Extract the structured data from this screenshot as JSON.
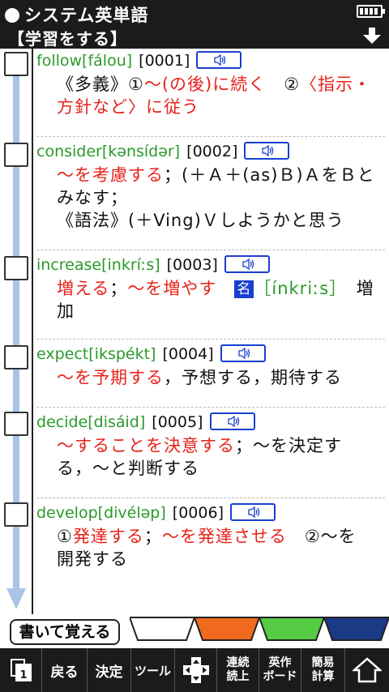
{
  "header": {
    "title": "システム英単語",
    "subtitle": "【学習をする】"
  },
  "entries": [
    {
      "word": "follow",
      "pron": "[fálou]",
      "number": "[0001]",
      "def_lines": [
        [
          {
            "t": "《多義》①",
            "c": ""
          },
          {
            "t": "〜(の後)に続く",
            "c": "red"
          },
          {
            "t": "　②",
            "c": ""
          },
          {
            "t": "〈指示・",
            "c": "red"
          }
        ],
        [
          {
            "t": "方針など〉に従う",
            "c": "red"
          }
        ]
      ]
    },
    {
      "word": "consider",
      "pron": "[kənsídər]",
      "number": "[0002]",
      "def_lines": [
        [
          {
            "t": "〜を考慮する",
            "c": "red"
          },
          {
            "t": "；(＋Ａ＋(as)Ｂ)ＡをＢと",
            "c": ""
          }
        ],
        [
          {
            "t": "みなす；",
            "c": ""
          }
        ],
        [
          {
            "t": "《語法》(＋Ving)Ｖしようかと思う",
            "c": ""
          }
        ]
      ]
    },
    {
      "word": "increase",
      "pron": "[inkríːs]",
      "number": "[0003]",
      "def_lines": [
        [
          {
            "t": "増える",
            "c": "red"
          },
          {
            "t": "；",
            "c": ""
          },
          {
            "t": "〜を増やす",
            "c": "red"
          },
          {
            "t": "　",
            "c": ""
          },
          {
            "t": "名",
            "c": "badge"
          },
          {
            "t": "［ínkriːs］",
            "c": "green"
          },
          {
            "t": "　増",
            "c": ""
          }
        ],
        [
          {
            "t": "加",
            "c": ""
          }
        ]
      ]
    },
    {
      "word": "expect",
      "pron": "[ikspékt]",
      "number": "[0004]",
      "def_lines": [
        [
          {
            "t": "〜を予期する",
            "c": "red"
          },
          {
            "t": "，予想する，期待する",
            "c": ""
          }
        ]
      ]
    },
    {
      "word": "decide",
      "pron": "[disáid]",
      "number": "[0005]",
      "def_lines": [
        [
          {
            "t": "〜することを決意する",
            "c": "red"
          },
          {
            "t": "；〜を決定す",
            "c": ""
          }
        ],
        [
          {
            "t": "る，〜と判断する",
            "c": ""
          }
        ]
      ]
    },
    {
      "word": "develop",
      "pron": "[divéləp]",
      "number": "[0006]",
      "def_lines": [
        [
          {
            "t": "①",
            "c": ""
          },
          {
            "t": "発達する",
            "c": "red"
          },
          {
            "t": "；",
            "c": ""
          },
          {
            "t": "〜を発達させる",
            "c": "red"
          },
          {
            "t": "　②〜を",
            "c": ""
          }
        ],
        [
          {
            "t": "開発する",
            "c": ""
          }
        ]
      ]
    }
  ],
  "tabs": {
    "write_label": "書いて覚える",
    "colors": [
      "#ffffff",
      "#f06a1e",
      "#55cc44",
      "#1a3a86"
    ]
  },
  "toolbar": {
    "page_num": "1",
    "back": "戻る",
    "enter": "決定",
    "tools": "ツール",
    "continuous_read_1": "連続",
    "continuous_read_2": "読上",
    "eng_kb_1": "英作",
    "eng_kb_2": "ボード",
    "simple_calc_1": "簡易",
    "simple_calc_2": "計算",
    "home_icon": "home-icon"
  },
  "colors": {
    "dark": "#1b1b1b",
    "red": "#e8221a",
    "green": "#2a9a2a",
    "blue": "#1a3fd0",
    "scroll": "#a8c4e8"
  }
}
